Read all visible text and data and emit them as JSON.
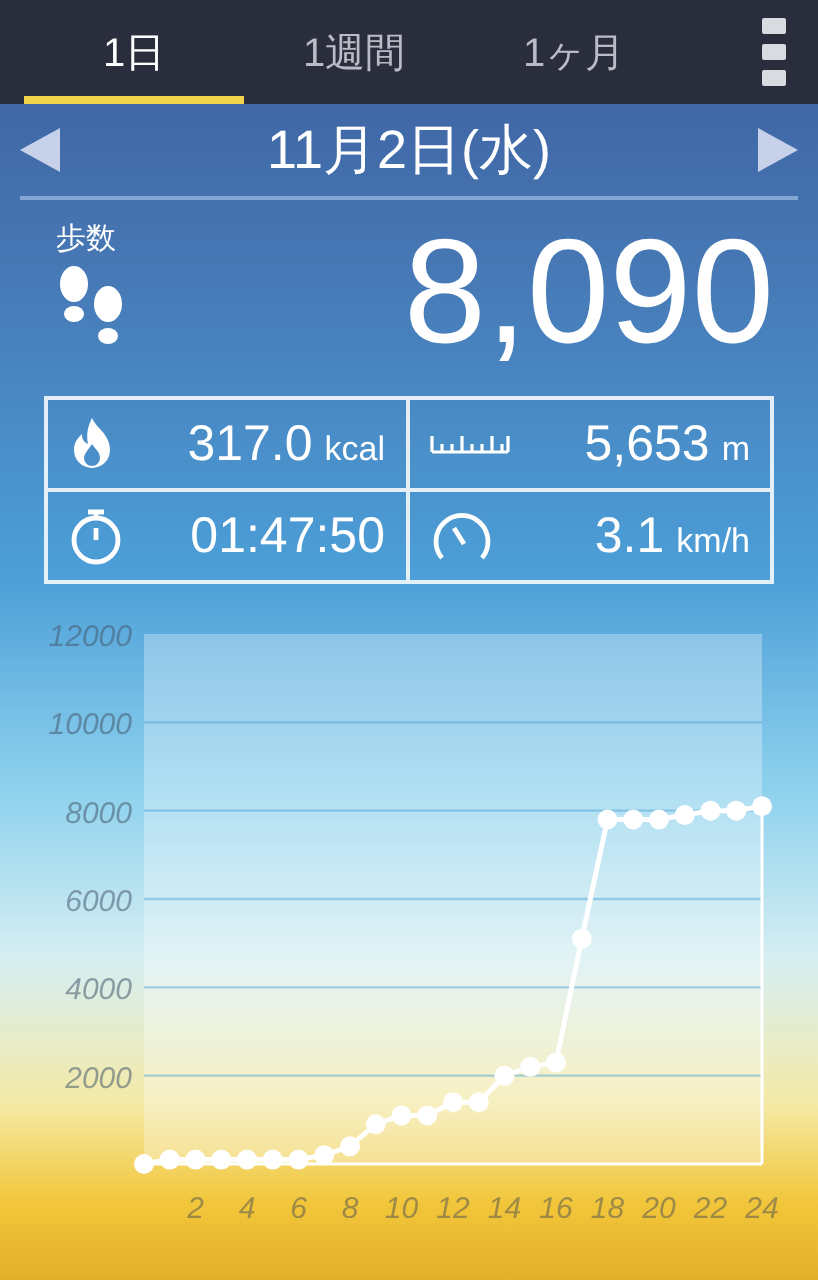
{
  "tabs": [
    {
      "label": "1日",
      "selected": true
    },
    {
      "label": "1週間",
      "selected": false
    },
    {
      "label": "1ヶ月",
      "selected": false
    }
  ],
  "date_nav": {
    "date": "11月2日(水)"
  },
  "steps": {
    "label": "歩数",
    "value": "8,090"
  },
  "stats": [
    {
      "kind": "calories",
      "value": "317.0",
      "unit": "kcal"
    },
    {
      "kind": "distance",
      "value": "5,653",
      "unit": "m"
    },
    {
      "kind": "time",
      "value": "01:47:50"
    },
    {
      "kind": "speed",
      "value": "3.1",
      "unit": "km/h"
    }
  ],
  "chart": {
    "chart_data": {
      "type": "line",
      "x": [
        0,
        1,
        2,
        3,
        4,
        5,
        6,
        7,
        8,
        9,
        10,
        11,
        12,
        13,
        14,
        15,
        16,
        17,
        18,
        19,
        20,
        21,
        22,
        23,
        24
      ],
      "xlim": [
        0,
        24
      ],
      "ylim": [
        0,
        12000
      ],
      "xticks": [
        2,
        4,
        6,
        8,
        10,
        12,
        14,
        16,
        18,
        20,
        22,
        24
      ],
      "yticks": [
        2000,
        4000,
        6000,
        8000,
        10000,
        12000
      ],
      "grid": true,
      "series": [
        {
          "color": "#ffffff",
          "marker": true,
          "values": [
            0,
            100,
            100,
            100,
            100,
            100,
            100,
            200,
            400,
            900,
            1100,
            1100,
            1400,
            1400,
            2000,
            2200,
            2300,
            5100,
            7800,
            7800,
            7800,
            7900,
            8000,
            8000,
            8100
          ]
        }
      ]
    }
  }
}
